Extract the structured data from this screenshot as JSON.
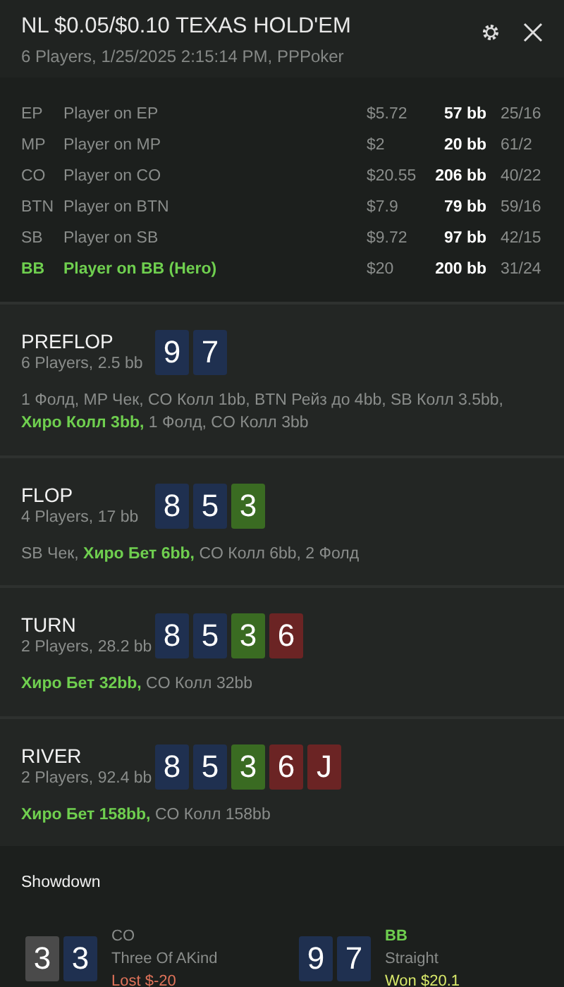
{
  "header": {
    "title": "NL $0.05/$0.10 TEXAS HOLD'EM",
    "subtitle": "6 Players, 1/25/2025 2:15:14 PM, PPPoker"
  },
  "players": [
    {
      "position": "EP",
      "name": "Player on EP",
      "stack": "$5.72",
      "bb": "57 bb",
      "stats": "25/16",
      "hero": false
    },
    {
      "position": "MP",
      "name": "Player on MP",
      "stack": "$2",
      "bb": "20 bb",
      "stats": "61/2",
      "hero": false
    },
    {
      "position": "CO",
      "name": "Player on CO",
      "stack": "$20.55",
      "bb": "206 bb",
      "stats": "40/22",
      "hero": false
    },
    {
      "position": "BTN",
      "name": "Player on BTN",
      "stack": "$7.9",
      "bb": "79 bb",
      "stats": "59/16",
      "hero": false
    },
    {
      "position": "SB",
      "name": "Player on SB",
      "stack": "$9.72",
      "bb": "97 bb",
      "stats": "42/15",
      "hero": false
    },
    {
      "position": "BB",
      "name": "Player on BB (Hero)",
      "stack": "$20",
      "bb": "200 bb",
      "stats": "31/24",
      "hero": true
    }
  ],
  "streets": [
    {
      "name": "PREFLOP",
      "info": "6 Players, 2.5 bb",
      "cards": [
        {
          "rank": "9",
          "color": "#1f3050"
        },
        {
          "rank": "7",
          "color": "#1f3050"
        }
      ],
      "actions": "1 Фолд, MP Чек, CO Колл 1bb, BTN Рейз до 4bb, SB Колл 3.5bb, **Хиро Колл 3bb,** 1 Фолд, CO Колл 3bb"
    },
    {
      "name": "FLOP",
      "info": "4 Players, 17 bb",
      "cards": [
        {
          "rank": "8",
          "color": "#1f3050"
        },
        {
          "rank": "5",
          "color": "#1f3050"
        },
        {
          "rank": "3",
          "color": "#3a6b22"
        }
      ],
      "actions": "SB Чек, **Хиро Бет 6bb,** CO Колл 6bb, 2 Фолд"
    },
    {
      "name": "TURN",
      "info": "2 Players, 28.2 bb",
      "cards": [
        {
          "rank": "8",
          "color": "#1f3050"
        },
        {
          "rank": "5",
          "color": "#1f3050"
        },
        {
          "rank": "3",
          "color": "#3a6b22"
        },
        {
          "rank": "6",
          "color": "#6b2424"
        }
      ],
      "actions": "**Хиро Бет 32bb,** CO Колл 32bb"
    },
    {
      "name": "RIVER",
      "info": "2 Players, 92.4 bb",
      "cards": [
        {
          "rank": "8",
          "color": "#1f3050"
        },
        {
          "rank": "5",
          "color": "#1f3050"
        },
        {
          "rank": "3",
          "color": "#3a6b22"
        },
        {
          "rank": "6",
          "color": "#6b2424"
        },
        {
          "rank": "J",
          "color": "#6b2424"
        }
      ],
      "actions": "**Хиро Бет 158bb,** CO Колл 158bb"
    }
  ],
  "showdown": {
    "title": "Showdown",
    "hands": [
      {
        "position": "CO",
        "hero": false,
        "cards": [
          {
            "rank": "3",
            "color": "#4a4a4a"
          },
          {
            "rank": "3",
            "color": "#1f3050"
          }
        ],
        "hand": "Three Of AKind",
        "result": "Lost $-20",
        "kind": "lost"
      },
      {
        "position": "BB",
        "hero": true,
        "cards": [
          {
            "rank": "9",
            "color": "#1f3050"
          },
          {
            "rank": "7",
            "color": "#1f3050"
          }
        ],
        "hand": "Straight",
        "result": "Won $20.1",
        "kind": "won"
      }
    ]
  }
}
